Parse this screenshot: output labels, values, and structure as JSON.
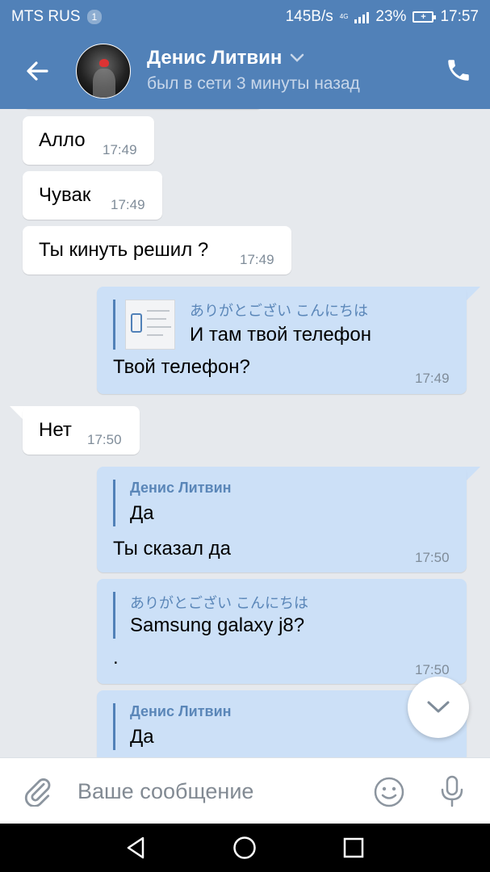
{
  "status_bar": {
    "carrier": "MTS RUS",
    "sim_badge": "1",
    "speed": "145B/s",
    "network": "4G",
    "battery": "23%",
    "time": "17:57"
  },
  "header": {
    "contact_name": "Денис Литвин",
    "contact_status": "был в сети 3 минуты назад"
  },
  "messages": [
    {
      "dir": "in",
      "text": "Алло",
      "time": "17:49"
    },
    {
      "dir": "in",
      "text": "Чувак",
      "time": "17:49"
    },
    {
      "dir": "in",
      "text": "Ты кинуть решил ?",
      "time": "17:49"
    },
    {
      "dir": "out",
      "reply_name": "ありがとござい こんにちは",
      "reply_text": "И там твой телефон",
      "text": "Твой телефон?",
      "time": "17:49"
    },
    {
      "dir": "in",
      "text": "Нет",
      "time": "17:50"
    },
    {
      "dir": "out",
      "reply_name": "Денис Литвин",
      "reply_text": "Да",
      "text": "Ты сказал да",
      "time": "17:50"
    },
    {
      "dir": "out",
      "reply_name": "ありがとござい こんにちは",
      "reply_text": "Samsung galaxy j8?",
      "text": ".",
      "time": "17:50"
    },
    {
      "dir": "out",
      "reply_name": "Денис Литвин",
      "reply_text": "Да",
      "text": "",
      "time": ""
    }
  ],
  "composer": {
    "placeholder": "Ваше сообщение"
  },
  "colors": {
    "header": "#5181b8",
    "incoming_bubble": "#ffffff",
    "outgoing_bubble": "#cce0f7",
    "chat_background": "#e6e9ed"
  },
  "icons": {
    "back": "arrow-left-icon",
    "call": "phone-icon",
    "attach": "paperclip-icon",
    "emoji": "smile-icon",
    "mic": "microphone-icon",
    "scroll_down": "chevron-down-icon"
  }
}
